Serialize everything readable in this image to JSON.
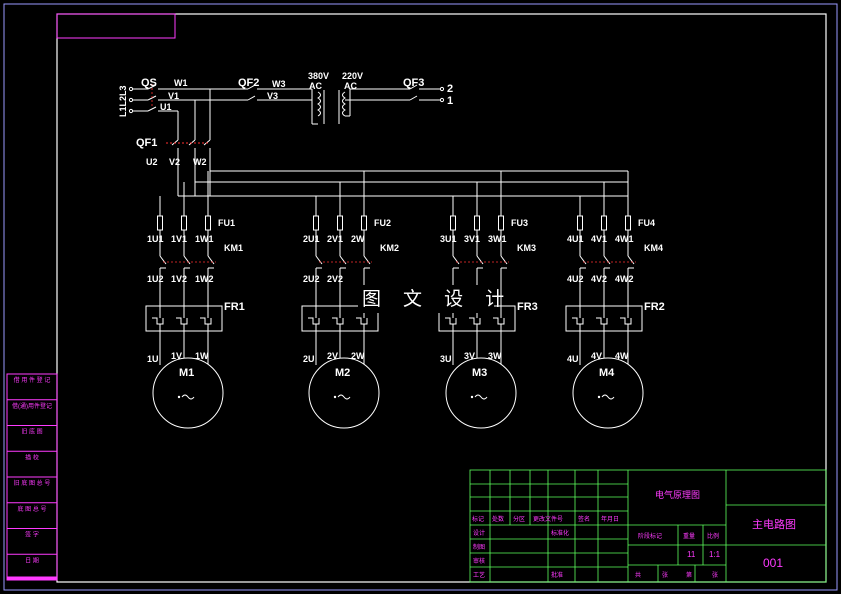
{
  "watermark": "图 文 设 计",
  "supply": {
    "phases": "L1L2L3",
    "qs": "QS",
    "w1": "W1",
    "v1": "V1",
    "u1": "U1",
    "qf2": "QF2",
    "w3": "W3",
    "v3": "V3",
    "v380": "380V",
    "ac1": "AC",
    "v220": "220V",
    "ac2": "AC",
    "qf3": "QF3",
    "out2": "2",
    "out1": "1",
    "qf1": "QF1",
    "u2": "U2",
    "v2": "V2",
    "w2": "W2"
  },
  "branches": [
    {
      "fu": "FU1",
      "km": "KM1",
      "fr": "FR1",
      "motor": "M1",
      "top": [
        "1U1",
        "1V1",
        "1W1"
      ],
      "mid": [
        "1U2",
        "1V2",
        "1W2"
      ],
      "bot": [
        "1U",
        "1V",
        "1W"
      ]
    },
    {
      "fu": "FU2",
      "km": "KM2",
      "fr": "",
      "motor": "M2",
      "top": [
        "2U1",
        "2V1",
        "2W"
      ],
      "mid": [
        "2U2",
        "2V2",
        ""
      ],
      "bot": [
        "2U",
        "2V",
        "2W"
      ]
    },
    {
      "fu": "FU3",
      "km": "KM3",
      "fr": "FR3",
      "motor": "M3",
      "top": [
        "3U1",
        "3V1",
        "3W1"
      ],
      "mid": [
        "",
        "",
        ""
      ],
      "bot": [
        "3U",
        "3V",
        "3W"
      ]
    },
    {
      "fu": "FU4",
      "km": "KM4",
      "fr": "FR2",
      "motor": "M4",
      "top": [
        "4U1",
        "4V1",
        "4W1"
      ],
      "mid": [
        "4U2",
        "4V2",
        "4W2"
      ],
      "bot": [
        "4U",
        "4V",
        "4W"
      ]
    }
  ],
  "side_panel": [
    "借 用 件 登 记",
    "借(通)用件登记",
    "旧 底 图",
    "描 校",
    "旧 底 图 总 号",
    "底 图 总 号",
    "签 字",
    "日 期"
  ],
  "title_block": {
    "title": "电气原理图",
    "drawing_name": "主电路图",
    "drawing_no": "001",
    "row_mark": "标记",
    "row_count": "处数",
    "row_zone": "分区",
    "row_docno": "更改文件号",
    "row_sign": "签名",
    "row_date": "年月日",
    "design": "设计",
    "draw": "制图",
    "check": "审核",
    "process": "工艺",
    "standard": "标准化",
    "approve": "批准",
    "stage_mark": "阶段标记",
    "weight": "重量",
    "scale": "比例",
    "weight_val": "11",
    "scale_val": "1:1",
    "total": "共",
    "sheet_word": "张",
    "page": "第",
    "page_word": "张"
  },
  "colors": {
    "frame": "#ffffff",
    "wire": "#ffffff",
    "magenta": "#ff3bff",
    "titleblock": "#5dff5d",
    "dashed": "#ff3030"
  }
}
